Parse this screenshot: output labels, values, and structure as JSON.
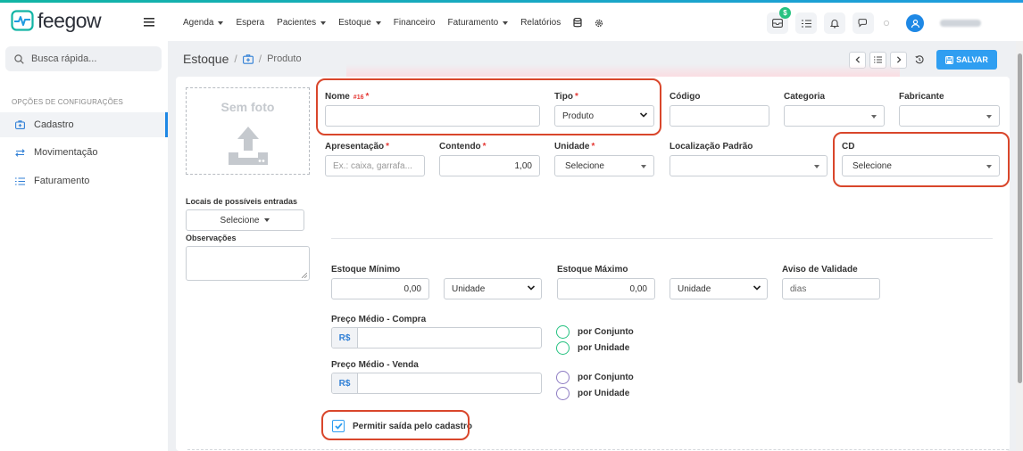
{
  "app": {
    "name": "feegow"
  },
  "nav": {
    "items": [
      {
        "label": "Agenda",
        "dropdown": true
      },
      {
        "label": "Espera",
        "dropdown": false
      },
      {
        "label": "Pacientes",
        "dropdown": true
      },
      {
        "label": "Estoque",
        "dropdown": true
      },
      {
        "label": "Financeiro",
        "dropdown": false
      },
      {
        "label": "Faturamento",
        "dropdown": true
      },
      {
        "label": "Relatórios",
        "dropdown": false
      }
    ],
    "icons": [
      "database-icon",
      "settings-icon"
    ]
  },
  "header": {
    "notification_badge": "$",
    "icons": [
      "inbox-icon",
      "task-list-icon",
      "bell-icon",
      "chat-icon",
      "status-dot-icon",
      "user-avatar-icon"
    ]
  },
  "sidebar": {
    "search_placeholder": "Busca rápida...",
    "section_title": "OPÇÕES DE CONFIGURAÇÕES",
    "items": [
      {
        "label": "Cadastro",
        "icon": "medical-case-icon",
        "active": true
      },
      {
        "label": "Movimentação",
        "icon": "swap-arrows-icon",
        "active": false
      },
      {
        "label": "Faturamento",
        "icon": "list-icon",
        "active": false
      }
    ]
  },
  "breadcrumb": {
    "root": "Estoque",
    "separator": "/",
    "current": "Produto"
  },
  "toolbar": {
    "save_label": "SALVAR"
  },
  "form": {
    "photo_label": "Sem foto",
    "nome": {
      "label": "Nome",
      "tag": "#16",
      "required": true,
      "value": ""
    },
    "tipo": {
      "label": "Tipo",
      "required": true,
      "value": "Produto"
    },
    "codigo": {
      "label": "Código",
      "value": ""
    },
    "categoria": {
      "label": "Categoria",
      "value": ""
    },
    "fabricante": {
      "label": "Fabricante",
      "value": ""
    },
    "apresentacao": {
      "label": "Apresentação",
      "required": true,
      "placeholder": "Ex.: caixa, garrafa..."
    },
    "contendo": {
      "label": "Contendo",
      "required": true,
      "value": "1,00"
    },
    "unidade": {
      "label": "Unidade",
      "required": true,
      "value": "Selecione"
    },
    "localizacao": {
      "label": "Localização Padrão",
      "value": ""
    },
    "cd": {
      "label": "CD",
      "value": "Selecione"
    },
    "locais": {
      "label": "Locais de possíveis entradas",
      "value": "Selecione"
    },
    "observacoes": {
      "label": "Observações",
      "value": ""
    },
    "estoque_minimo": {
      "label": "Estoque Mínimo",
      "value": "0,00",
      "unit": "Unidade"
    },
    "estoque_maximo": {
      "label": "Estoque Máximo",
      "value": "0,00",
      "unit": "Unidade"
    },
    "aviso_validade": {
      "label": "Aviso de Validade",
      "placeholder": "dias"
    },
    "preco_compra": {
      "label": "Preço Médio - Compra",
      "prefix": "R$",
      "value": "",
      "options": [
        "por Conjunto",
        "por Unidade"
      ]
    },
    "preco_venda": {
      "label": "Preço Médio - Venda",
      "prefix": "R$",
      "value": "",
      "options": [
        "por Conjunto",
        "por Unidade"
      ]
    },
    "permitir_saida": {
      "label": "Permitir saída pelo cadastro",
      "checked": true
    }
  },
  "colors": {
    "accent": "#2f9ef1",
    "highlight": "#d9462b",
    "success": "#26c281",
    "required": "#e53935"
  }
}
